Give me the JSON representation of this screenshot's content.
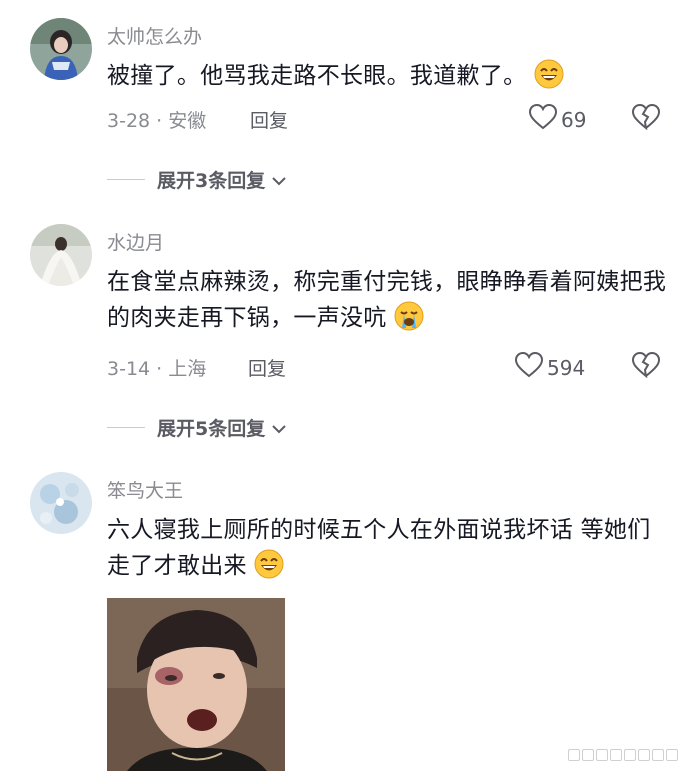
{
  "comments": [
    {
      "username": "太帅怎么办",
      "text": "被撞了。他骂我走路不长眼。我道歉了。",
      "date_location": "3-28 · 安徽",
      "reply_label": "回复",
      "likes": "69",
      "expand_label": "展开3条回复",
      "emoji": "grin-emoji"
    },
    {
      "username": "水边月",
      "text": "在食堂点麻辣烫，称完重付完钱，眼睁睁看着阿姨把我的肉夹走再下锅，一声没吭",
      "date_location": "3-14 · 上海",
      "reply_label": "回复",
      "likes": "594",
      "expand_label": "展开5条回复",
      "emoji": "crying-emoji"
    },
    {
      "username": "笨鸟大王",
      "text": "六人寝我上厕所的时候五个人在外面说我坏话 等她们走了才敢出来",
      "emoji": "grin-emoji"
    }
  ],
  "colors": {
    "secondary_text": "#8a8b91",
    "primary_text": "#161823",
    "action_text": "#5a5b63"
  }
}
